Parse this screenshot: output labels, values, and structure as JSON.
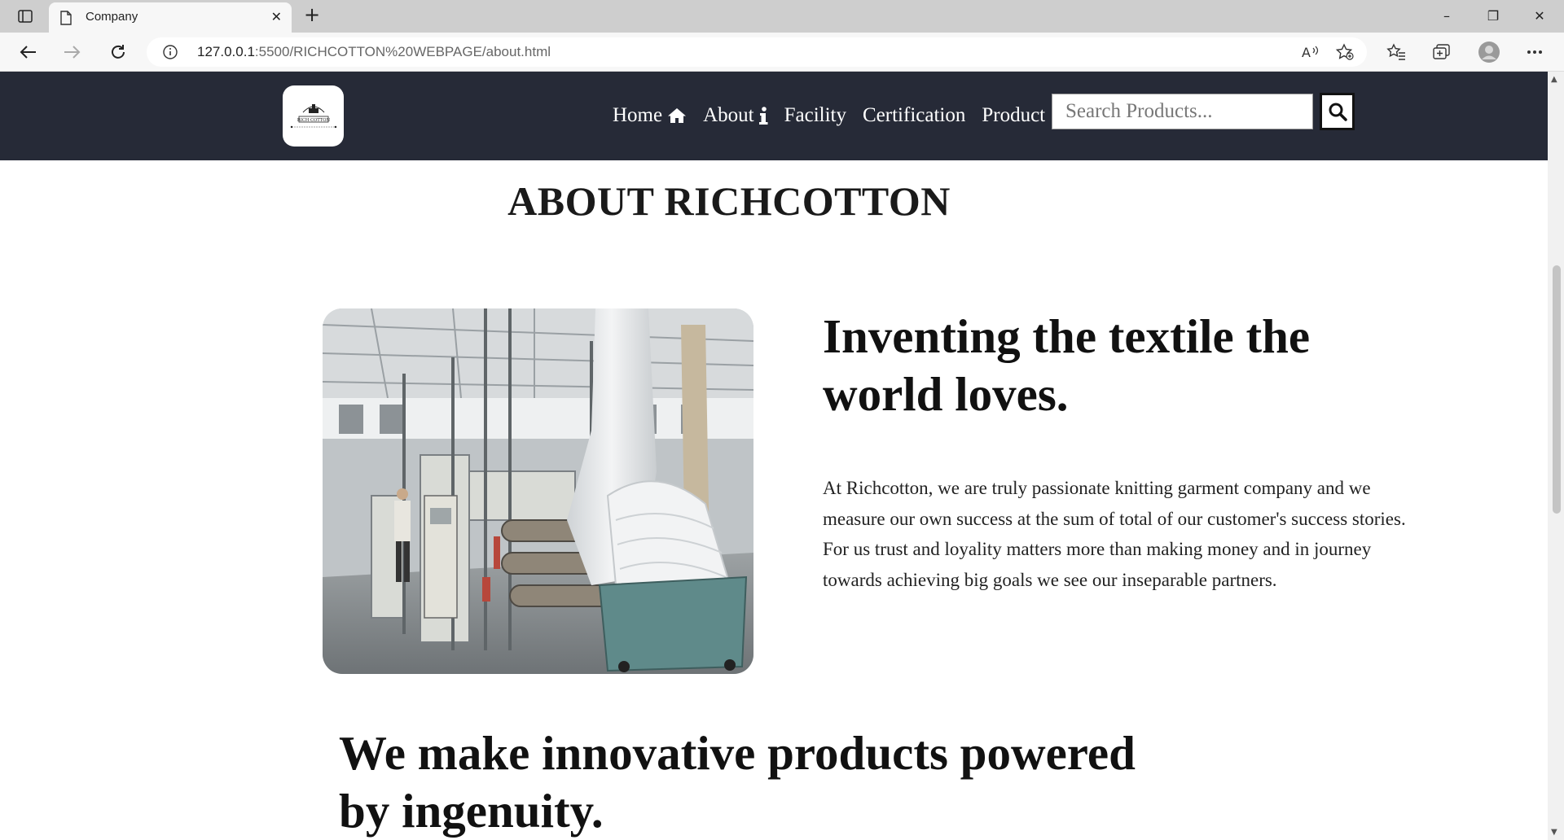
{
  "browser": {
    "tab_title": "Company",
    "url_host": "127.0.0.1",
    "url_rest": ":5500/RICHCOTTON%20WEBPAGE/about.html"
  },
  "nav": {
    "logo_text": "RICH COTTON",
    "items": [
      {
        "label": "Home",
        "icon": "home-icon"
      },
      {
        "label": "About",
        "icon": "info-icon"
      },
      {
        "label": "Facility"
      },
      {
        "label": "Certification"
      },
      {
        "label": "Product"
      }
    ],
    "search_placeholder": "Search Products...",
    "background": "#262a37"
  },
  "main": {
    "title": "ABOUT RICHCOTTON",
    "headline": "Inventing the textile the world loves.",
    "body": "At Richcotton, we are truly passionate knitting garment company and we measure our own success at the sum of total of our customer's success stories. For us trust and loyality matters more than making money and in journey towards achieving big goals we see our inseparable partners.",
    "subheadline": "We make innovative products powered by ingenuity."
  }
}
